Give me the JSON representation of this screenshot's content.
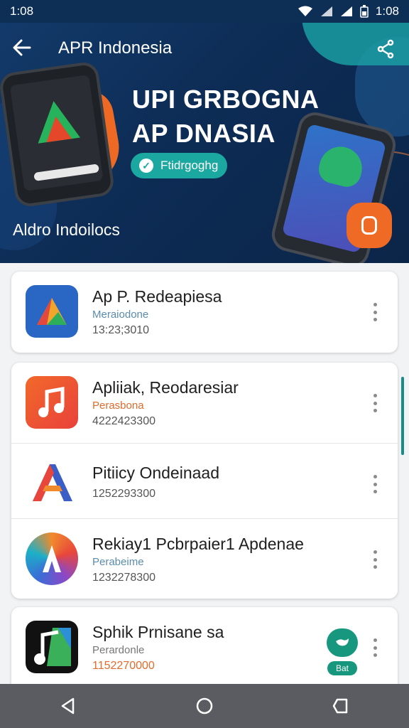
{
  "status": {
    "time_left": "1:08",
    "time_right": "1:08"
  },
  "header": {
    "title": "APR Indonesia"
  },
  "hero": {
    "title_line1": "UPI GRBOGNA",
    "title_line2": "AP DNASIA",
    "badge_label": "Ftidrgoghg",
    "subtitle": "Aldro Indoilocs"
  },
  "apps": [
    {
      "name": "Ap P. Redeapiesa",
      "tag": "Meraiodone",
      "number": "13:23;3010",
      "tag_color": "#5a8cae",
      "icon": "drive-triangle-icon"
    },
    {
      "name": "Apliiak, Reodaresiar",
      "tag": "Perasbona",
      "number": "4222423300",
      "tag_color": "#e26b2c",
      "icon": "music-note-icon"
    },
    {
      "name": "Pitiicy Ondeinaad",
      "tag": "",
      "number": "1252293300",
      "tag_color": "#5a8cae",
      "icon": "letter-a-icon"
    },
    {
      "name": "Rekiay1 Pcbrpaier1 Apdenae",
      "tag": "Perabeime",
      "number": "1232278300",
      "tag_color": "#5a8cae",
      "icon": "gradient-a-icon"
    },
    {
      "name": "Sphik Prnisane sa",
      "tag": "Perardonle",
      "number": "1152270000",
      "tag_color": "#777777",
      "icon": "music-app-icon",
      "chip_label": "Bat"
    }
  ],
  "colors": {
    "primary": "#0d2f56",
    "accent": "#ef6a25",
    "teal": "#1aa8a0"
  }
}
